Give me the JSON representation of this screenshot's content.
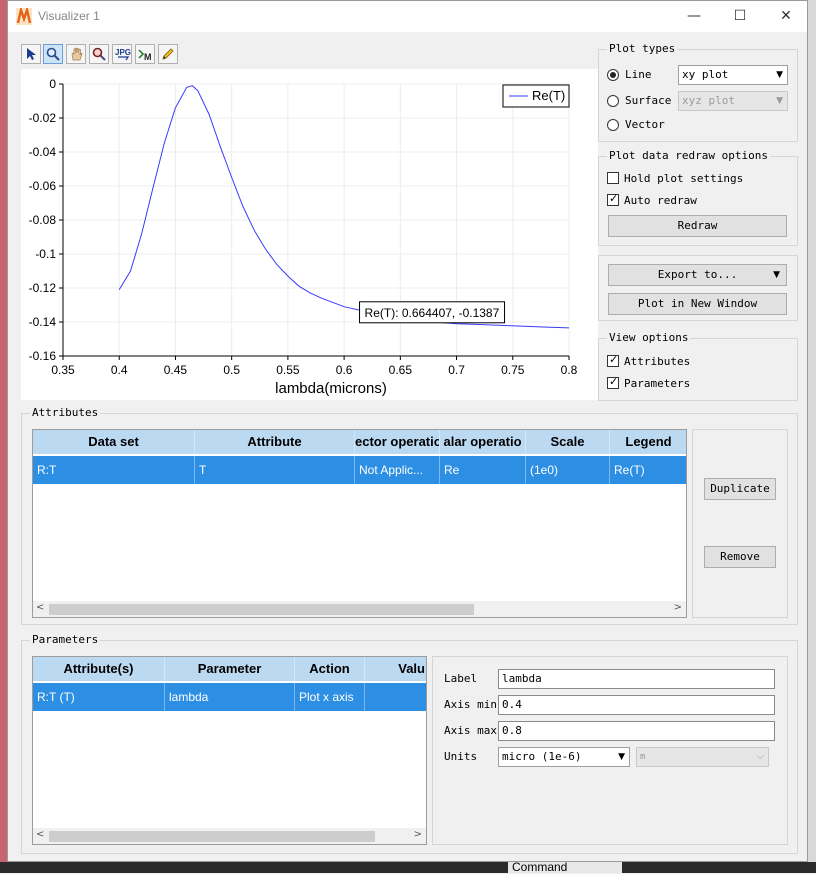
{
  "window": {
    "title": "Visualizer 1"
  },
  "toolbar": {
    "tools": [
      "pointer-tool",
      "zoom-tool",
      "pan-tool",
      "zoom-region-tool",
      "export-jpg-tool",
      "data-marker-tool",
      "draw-tool"
    ],
    "jpg_label": "JPG"
  },
  "chart_data": {
    "type": "line",
    "xlabel": "lambda(microns)",
    "ylabel": "",
    "xlim": [
      0.35,
      0.8
    ],
    "ylim": [
      -0.16,
      0
    ],
    "xticks": [
      "0.35",
      "0.4",
      "0.45",
      "0.5",
      "0.55",
      "0.6",
      "0.65",
      "0.7",
      "0.75",
      "0.8"
    ],
    "yticks": [
      "0",
      "-0.02",
      "-0.04",
      "-0.06",
      "-0.08",
      "-0.1",
      "-0.12",
      "-0.14",
      "-0.16"
    ],
    "grid": true,
    "legend": "top-right",
    "series": [
      {
        "name": "Re(T)",
        "color": "#3a3aff",
        "x": [
          0.4,
          0.41,
          0.42,
          0.43,
          0.44,
          0.45,
          0.46,
          0.465,
          0.47,
          0.48,
          0.49,
          0.5,
          0.51,
          0.52,
          0.53,
          0.54,
          0.55,
          0.56,
          0.57,
          0.58,
          0.6,
          0.62,
          0.64,
          0.66,
          0.68,
          0.7,
          0.72,
          0.74,
          0.76,
          0.78,
          0.8
        ],
        "y": [
          -0.121,
          -0.11,
          -0.088,
          -0.061,
          -0.035,
          -0.014,
          -0.002,
          -0.001,
          -0.004,
          -0.018,
          -0.037,
          -0.055,
          -0.072,
          -0.086,
          -0.097,
          -0.106,
          -0.113,
          -0.119,
          -0.123,
          -0.126,
          -0.131,
          -0.134,
          -0.136,
          -0.1385,
          -0.14,
          -0.141,
          -0.1415,
          -0.142,
          -0.1425,
          -0.143,
          -0.1435
        ]
      }
    ],
    "annotation": {
      "text": "Re(T): 0.664407, -0.1387",
      "x": 0.664407,
      "y": -0.1387
    }
  },
  "plot_types": {
    "title": "Plot types",
    "options": [
      {
        "label": "Line",
        "selected": true,
        "combo": "xy plot",
        "enabled": true
      },
      {
        "label": "Surface",
        "selected": false,
        "combo": "xyz plot",
        "enabled": false
      },
      {
        "label": "Vector",
        "selected": false
      }
    ]
  },
  "redraw": {
    "title": "Plot data redraw options",
    "hold_label": "Hold plot settings",
    "hold_checked": false,
    "auto_label": "Auto redraw",
    "auto_checked": true,
    "redraw_button": "Redraw"
  },
  "export": {
    "export_button": "Export to...",
    "new_window_button": "Plot in New Window"
  },
  "view_options": {
    "title": "View options",
    "attributes_label": "Attributes",
    "attributes_checked": true,
    "parameters_label": "Parameters",
    "parameters_checked": true
  },
  "attributes": {
    "title": "Attributes",
    "columns": [
      "Data set",
      "Attribute",
      "ector operatio",
      "alar operatio",
      "Scale",
      "Legend"
    ],
    "rows": [
      [
        "R:T",
        "T",
        "Not Applic...",
        "Re",
        "(1e0)",
        "Re(T)"
      ]
    ],
    "duplicate_button": "Duplicate",
    "remove_button": "Remove"
  },
  "parameters": {
    "title": "Parameters",
    "columns": [
      "Attribute(s)",
      "Parameter",
      "Action",
      "Valu"
    ],
    "rows": [
      [
        "R:T (T)",
        "lambda",
        "Plot x axis",
        ""
      ]
    ],
    "label_label": "Label",
    "label_value": "lambda",
    "axis_min_label": "Axis min",
    "axis_min_value": "0.4",
    "axis_max_label": "Axis max",
    "axis_max_value": "0.8",
    "units_label": "Units",
    "units_value": "micro (1e-6)",
    "units_base": "m"
  },
  "taskbar": {
    "command_label": "Command"
  }
}
